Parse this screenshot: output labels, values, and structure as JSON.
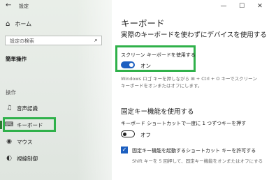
{
  "window": {
    "title": "設定",
    "back_icon": "←",
    "minimize": "—",
    "maximize": "☐",
    "close": "✕"
  },
  "sidebar": {
    "home": {
      "icon": "⌂",
      "label": "ホーム"
    },
    "search": {
      "placeholder": "設定の検索",
      "icon": "⌕"
    },
    "category": "簡単操作",
    "section": "操作",
    "items": [
      {
        "icon": "♫",
        "label": "音声認識",
        "selected": false
      },
      {
        "icon": "⌨",
        "label": "キーボード",
        "selected": true
      },
      {
        "icon": "◉",
        "label": "マウス",
        "selected": false
      },
      {
        "icon": "◐",
        "label": "視線制御",
        "selected": false
      }
    ]
  },
  "main": {
    "title": "キーボード",
    "subheading": "実際のキーボードを使わずにデバイスを使用する",
    "onscreen": {
      "label": "スクリーン キーボードを使用する",
      "state": "オン",
      "on": true,
      "description": "Windows ロゴ キーを押しながら ⊞ + Ctrl + O キーでスクリーン キーボードをオンまたはオフにします。"
    },
    "sticky": {
      "heading": "固定キー機能を使用する",
      "label": "キーボード ショートカットで一度に 1 つずつキーを押す",
      "state": "オフ",
      "on": false,
      "checkbox_label": "固定キー機能を起動するショートカット キーを許可する",
      "checkbox_checked": true,
      "checkbox_description": "Shift キーを 5 回押して、固定キー機能をオンまたはオフにする"
    }
  },
  "colors": {
    "accent": "#1c5fc0",
    "highlight": "#2fb14a",
    "selected_bar": "#2b7a31"
  }
}
